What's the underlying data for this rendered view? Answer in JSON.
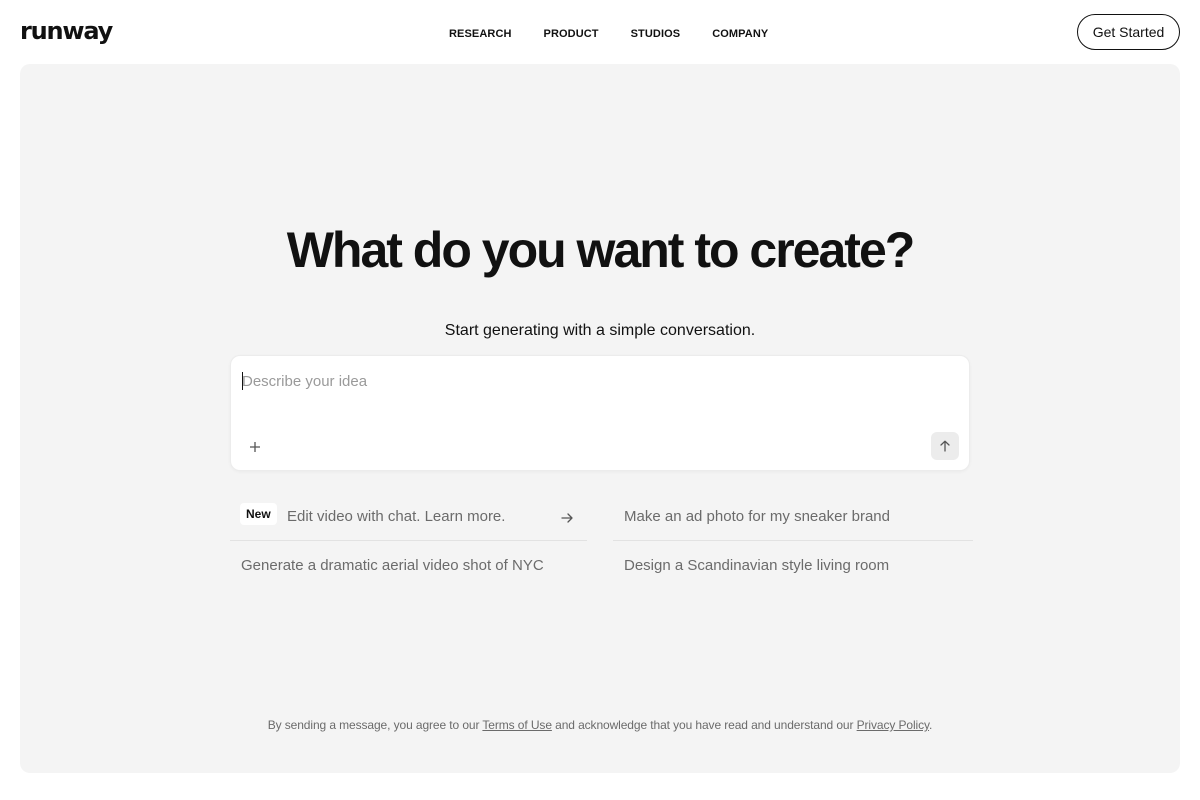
{
  "header": {
    "logo": "runway",
    "nav": [
      "RESEARCH",
      "PRODUCT",
      "STUDIOS",
      "COMPANY"
    ],
    "cta_label": "Get Started"
  },
  "hero": {
    "title": "What do you want to create?",
    "subtitle": "Start generating with a simple conversation."
  },
  "prompt": {
    "placeholder": "Describe your idea",
    "value": ""
  },
  "suggestions": {
    "badge": "New",
    "items": [
      "Edit video with chat. Learn more.",
      "Make an ad photo for my sneaker brand",
      "Generate a dramatic aerial video shot of NYC",
      "Design a Scandinavian style living room"
    ]
  },
  "legal": {
    "prefix": "By sending a message, you agree to our ",
    "terms_label": "Terms of Use",
    "middle": " and acknowledge that you have read and understand our ",
    "privacy_label": "Privacy Policy",
    "suffix": "."
  },
  "icons": {
    "add": "plus-icon",
    "send": "arrow-up-icon",
    "suggestion_arrow": "arrow-right-icon"
  },
  "colors": {
    "panel_bg": "#f4f4f4",
    "text": "#111111",
    "muted": "#6b6b6b"
  }
}
